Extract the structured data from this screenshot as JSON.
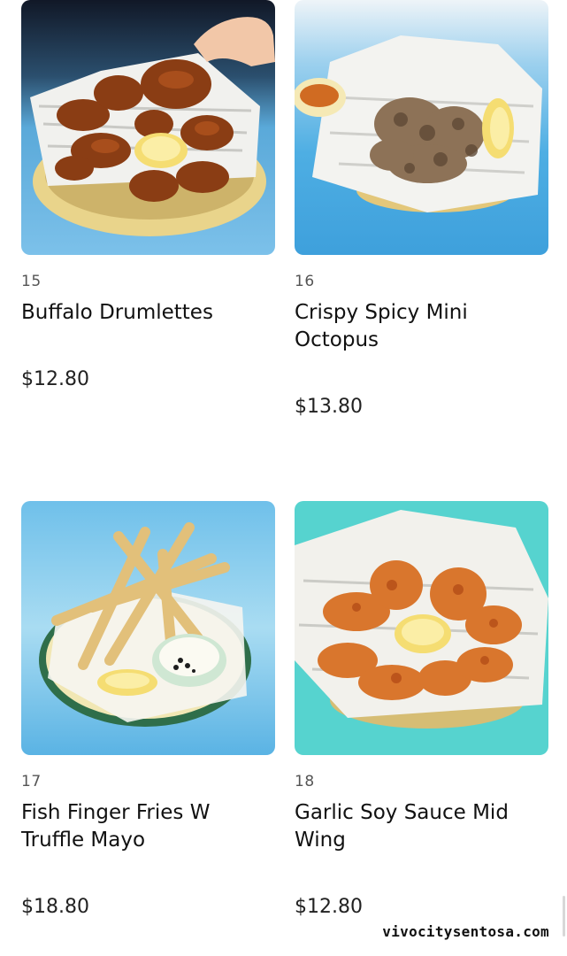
{
  "items": [
    {
      "number": "15",
      "name": "Buffalo Drumlettes",
      "price": "$12.80",
      "photo_icon": "buffalo-drumlettes-photo"
    },
    {
      "number": "16",
      "name": "Crispy Spicy Mini Octopus",
      "price": "$13.80",
      "photo_icon": "mini-octopus-photo"
    },
    {
      "number": "17",
      "name": "Fish Finger Fries W Truffle Mayo",
      "price": "$18.80",
      "photo_icon": "fish-finger-fries-photo"
    },
    {
      "number": "18",
      "name": "Garlic Soy Sauce Mid Wing",
      "price": "$12.80",
      "photo_icon": "garlic-soy-wing-photo"
    }
  ],
  "watermark": "vivocitysentosa.com",
  "colors": {
    "photo_blue": "#5db7e6",
    "photo_teal": "#56d3cf",
    "fried_brown": "#8a3d14",
    "fried_orange": "#d9762d",
    "lemon": "#f5dd72"
  }
}
